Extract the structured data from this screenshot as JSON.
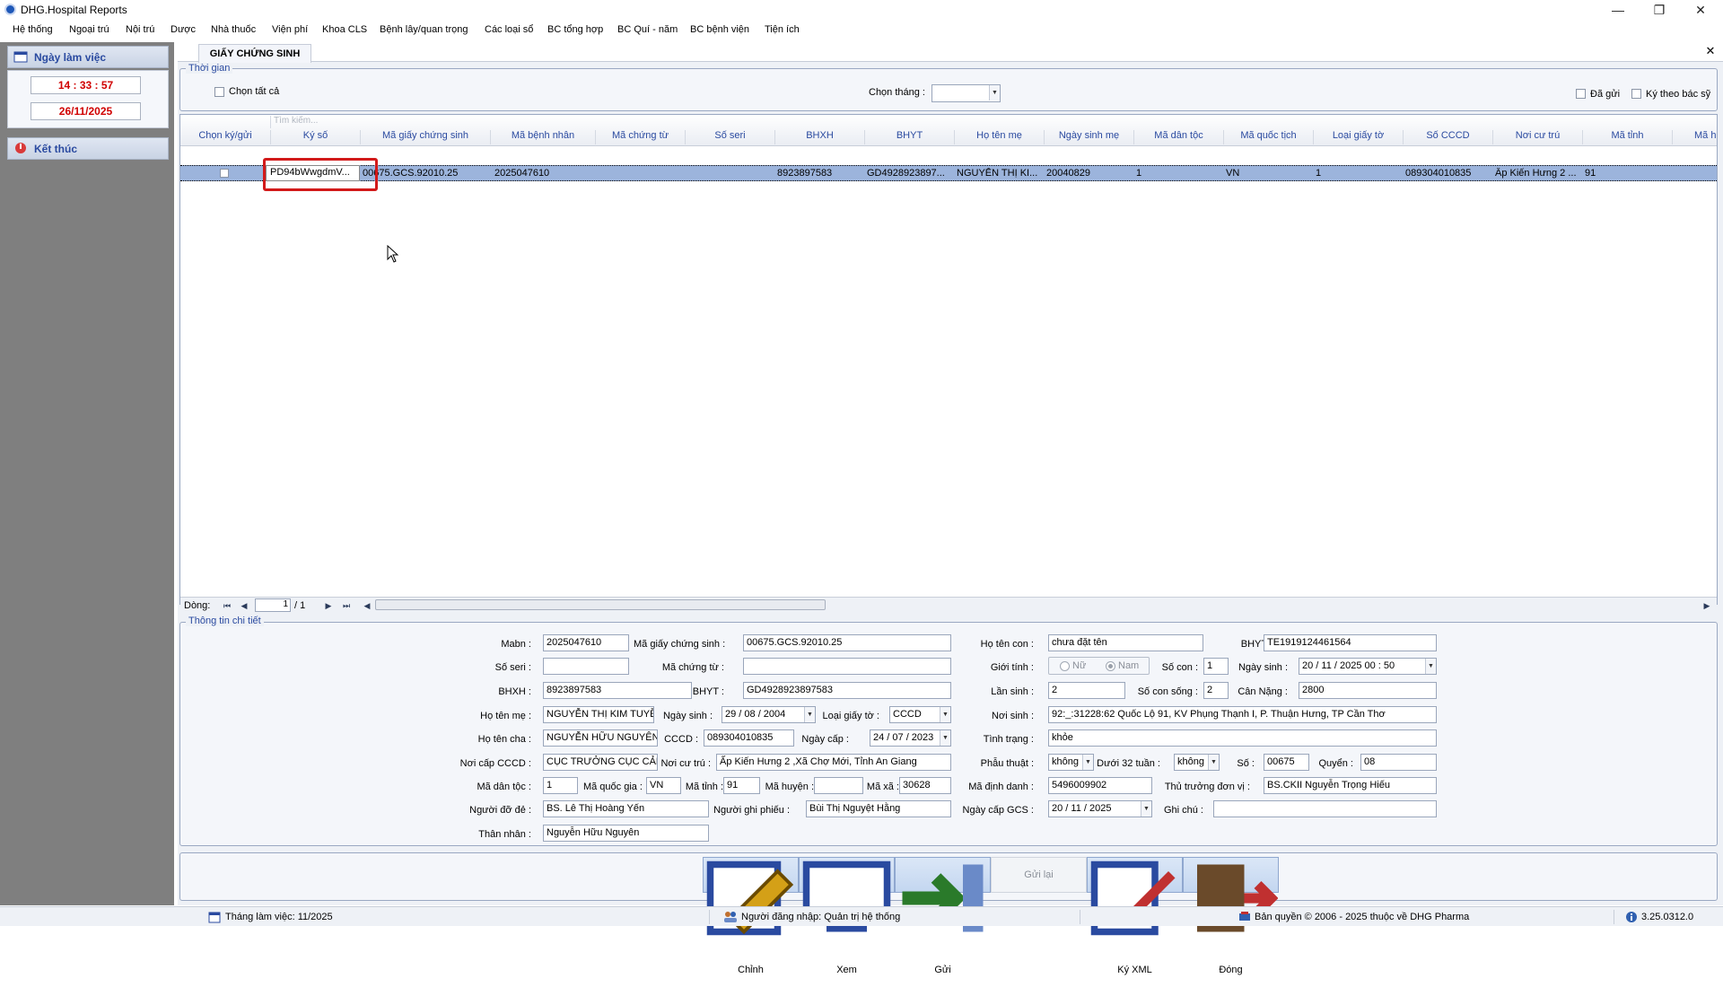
{
  "window": {
    "title": "DHG.Hospital Reports",
    "min": "—",
    "max": "❐",
    "close": "✕"
  },
  "menu": [
    "Hệ thống",
    "Ngoại trú",
    "Nội trú",
    "Dược",
    "Nhà thuốc",
    "Viện phí",
    "Khoa CLS",
    "Bệnh lây/quan trọng",
    "Các loại sổ",
    "BC tổng hợp",
    "BC Quí - năm",
    "BC bệnh viện",
    "Tiện ích"
  ],
  "left": {
    "workday_label": "Ngày làm việc",
    "time": "14 : 33 : 57",
    "date": "26/11/2025",
    "exit_label": "Kết thúc"
  },
  "tab": {
    "label": "GIẤY CHỨNG SINH",
    "close": "✕"
  },
  "time_group": {
    "title": "Thời gian",
    "select_all": "Chọn tất cả",
    "month_label": "Chọn tháng :",
    "month_value": "",
    "sent": "Đã gửi",
    "sign_by_doctor": "Ký theo bác sỹ"
  },
  "grid": {
    "filter_placeholder": "Tìm kiếm...",
    "columns": [
      "Chọn ký/gửi",
      "Ký số",
      "Mã giấy chứng sinh",
      "Mã bệnh nhân",
      "Mã chứng từ",
      "Số seri",
      "BHXH",
      "BHYT",
      "Họ tên mẹ",
      "Ngày sinh mẹ",
      "Mã dân tộc",
      "Mã quốc tịch",
      "Loại giấy tờ",
      "Số CCCD",
      "Nơi cư trú",
      "Mã tỉnh",
      "Mã h"
    ],
    "row": [
      "",
      "PD94bWwgdmV...",
      "00675.GCS.92010.25",
      "2025047610",
      "",
      "",
      "8923897583",
      "GD4928923897...",
      "NGUYỄN THỊ KI...",
      "20040829",
      "1",
      "VN",
      "1",
      "089304010835",
      "Ấp Kiến Hưng 2 ...",
      "91",
      ""
    ]
  },
  "nav": {
    "label": "Dòng:",
    "current": "1",
    "total": "/ 1"
  },
  "detail": {
    "title": "Thông tin chi tiết",
    "mabn_label": "Mabn :",
    "mabn": "2025047610",
    "magcs_label": "Mã giấy chứng sinh :",
    "magcs": "00675.GCS.92010.25",
    "hotencon_label": "Họ tên con :",
    "hotencon": "chưa đặt tên",
    "bhyt_con_label": "BHYT :",
    "bhyt_con": "TE1919124461564",
    "soseri_label": "Số seri :",
    "soseri": "",
    "machungtu_label": "Mã chứng từ :",
    "machungtu": "",
    "gioitinh_label": "Giới tính :",
    "gt_nu": "Nữ",
    "gt_nam": "Nam",
    "socon_label": "Số con :",
    "socon": "1",
    "ngaysinh_con_label": "Ngày sinh :",
    "ngaysinh_con": "20 / 11 / 2025   00 : 50",
    "bhxh_label": "BHXH :",
    "bhxh": "8923897583",
    "bhyt_me_label": "BHYT :",
    "bhyt_me": "GD4928923897583",
    "lansinh_label": "Lần sinh :",
    "lansinh": "2",
    "soconsong_label": "Số con sống :",
    "soconsong": "2",
    "cannang_label": "Cân Nặng :",
    "cannang": "2800",
    "hotenme_label": "Họ tên mẹ :",
    "hotenme": "NGUYỄN THỊ KIM TUYỀN",
    "ngaysinh_me_label": "Ngày sinh :",
    "ngaysinh_me": "29 / 08 / 2004",
    "loaigiayto_label": "Loại giấy tờ :",
    "loaigiayto": "CCCD",
    "noisinh_label": "Nơi sinh :",
    "noisinh": "92:_:31228:62 Quốc Lộ 91, KV Phụng Thạnh I, P. Thuận Hưng, TP Cần Thơ",
    "hotencha_label": "Họ tên cha :",
    "hotencha": "NGUYỄN HỮU NGUYÊN",
    "cccd_label": "CCCD :",
    "cccd": "089304010835",
    "ngaycap_label": "Ngày cấp :",
    "ngaycap": "24 / 07 / 2023",
    "tinhtrang_label": "Tình trạng :",
    "tinhtrang": "khỏe",
    "noicapcccd_label": "Nơi cấp CCCD :",
    "noicapcccd": "CỤC TRƯỞNG CỤC CẢNH",
    "noicutru_label": "Nơi cư trú :",
    "noicutru": "Ấp Kiến Hưng 2 ,Xã Chợ Mới, Tỉnh An Giang",
    "phauthuat_label": "Phẫu thuật :",
    "phauthuat": "không",
    "duoi32_label": "Dưới 32 tuần :",
    "duoi32": "không",
    "so_label": "Số :",
    "so": "00675",
    "quyen_label": "Quyển :",
    "quyen": "08",
    "madantoc_label": "Mã dân tộc :",
    "madantoc": "1",
    "maquocgia_label": "Mã quốc gia :",
    "maquocgia": "VN",
    "matinh_label": "Mã tỉnh :",
    "matinh": "91",
    "mahuyen_label": "Mã huyện :",
    "mahuyen": "",
    "maxa_label": "Mã xã :",
    "maxa": "30628",
    "madinhdanh_label": "Mã định danh :",
    "madinhdanh": "5496009902",
    "thutruong_label": "Thủ trưởng đơn vị :",
    "thutruong": "BS.CKII Nguyễn Trọng Hiếu",
    "nguoidode_label": "Người đỡ đẻ :",
    "nguoidode": "BS. Lê Thị Hoàng Yến",
    "nguoighiphieu_label": "Người ghi phiếu :",
    "nguoighiphieu": "Bùi Thị Nguyệt Hằng",
    "ngaycapgcs_label": "Ngày cấp GCS :",
    "ngaycapgcs": "20 / 11 / 2025",
    "ghichu_label": "Ghi chú :",
    "ghichu": "",
    "thannhan_label": "Thân nhân :",
    "thannhan": "Nguyễn Hữu Nguyên"
  },
  "buttons": {
    "chinh": "Chỉnh",
    "xem": "Xem",
    "gui": "Gửi",
    "guilai": "Gửi lại",
    "kyxml": "Ký XML",
    "dong": "Đóng"
  },
  "status": {
    "month": "Tháng làm việc: 11/2025",
    "user": "Người đăng nhập: Quản trị hệ thống",
    "copyright": "Bản quyền © 2006 - 2025 thuộc về DHG Pharma",
    "version": "3.25.0312.0"
  },
  "colors": {
    "accent": "#2a4aa0",
    "clock": "#d00000",
    "highlight": "#d21a1a",
    "selected_row": "#9cb4dc"
  }
}
